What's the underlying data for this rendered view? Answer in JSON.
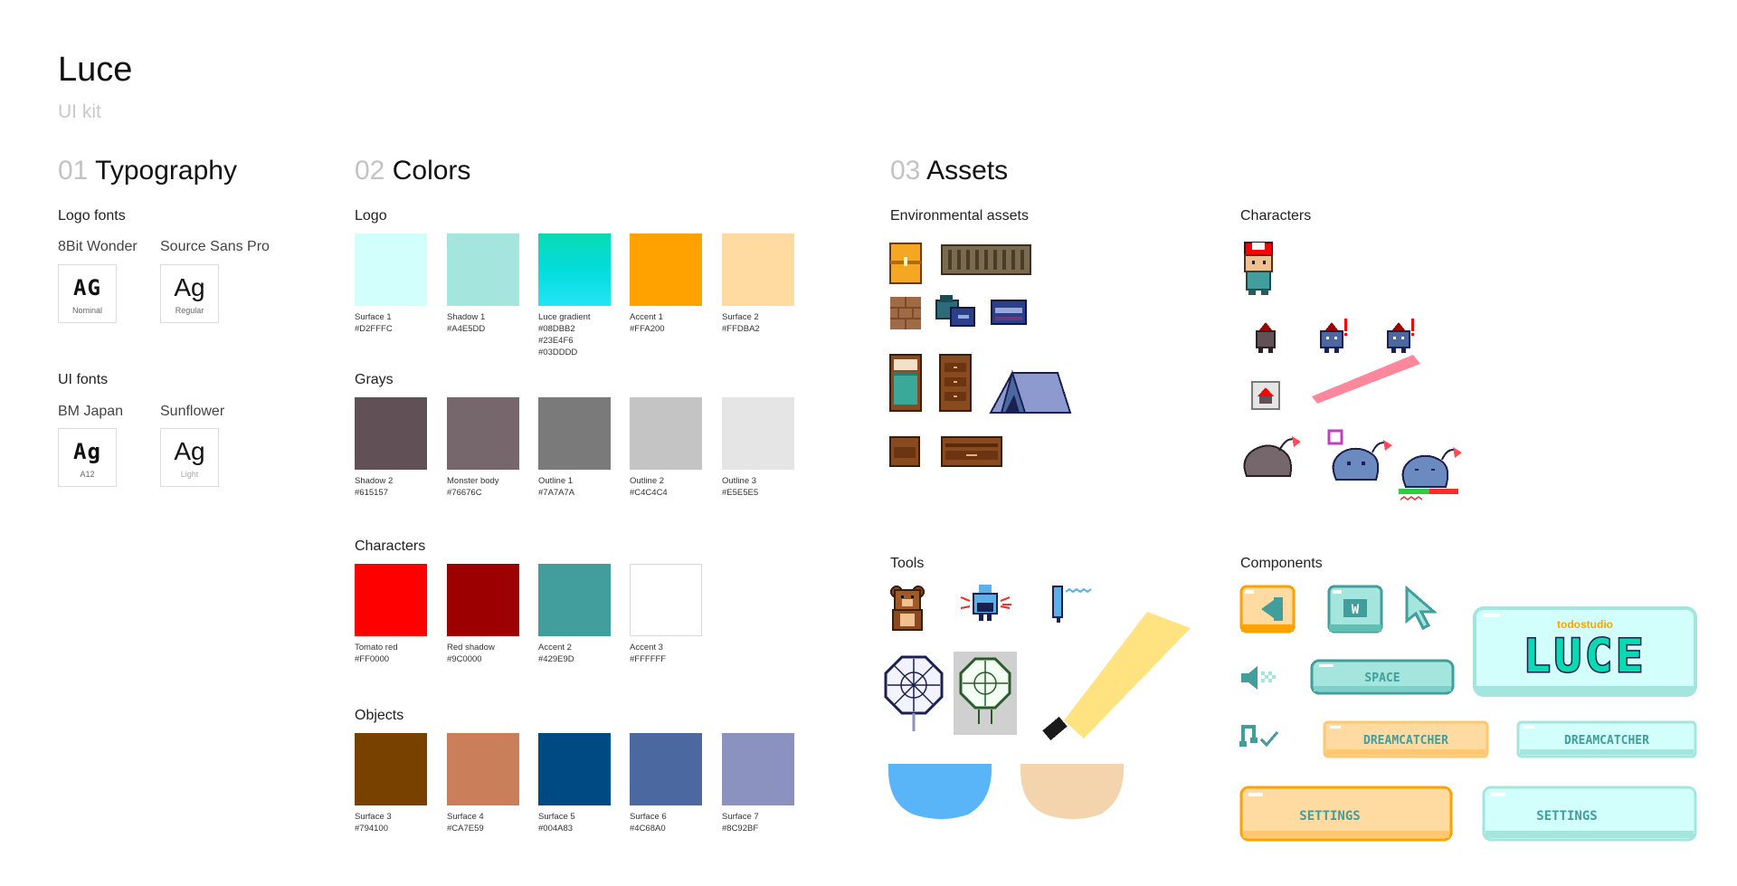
{
  "header": {
    "title": "Luce",
    "subtitle": "UI kit"
  },
  "typography": {
    "num": "01",
    "name": "Typography",
    "logo_fonts": {
      "label": "Logo fonts",
      "fonts": [
        {
          "name": "8Bit Wonder",
          "sample": "AG",
          "style": "Nominal"
        },
        {
          "name": "Source Sans Pro",
          "sample": "Ag",
          "style": "Regular"
        }
      ]
    },
    "ui_fonts": {
      "label": "UI fonts",
      "fonts": [
        {
          "name": "BM Japan",
          "sample": "Ag",
          "style": "A12"
        },
        {
          "name": "Sunflower",
          "sample": "Ag",
          "style": "Light"
        }
      ]
    }
  },
  "colors": {
    "num": "02",
    "name": "Colors",
    "groups": [
      {
        "label": "Logo",
        "swatches": [
          {
            "name": "Surface 1",
            "hex": [
              "#D2FFFC"
            ],
            "fill": "#D2FFFC"
          },
          {
            "name": "Shadow 1",
            "hex": [
              "#A4E5DD"
            ],
            "fill": "#A4E5DD"
          },
          {
            "name": "Luce gradient",
            "hex": [
              "#08DBB2",
              "#23E4F6",
              "#03DDDD"
            ],
            "fill": "#08DBB2",
            "gradient": [
              "#08DBB2",
              "#03DDDD",
              "#23E4F6"
            ]
          },
          {
            "name": "Accent 1",
            "hex": [
              "#FFA200"
            ],
            "fill": "#FFA200"
          },
          {
            "name": "Surface 2",
            "hex": [
              "#FFDBA2"
            ],
            "fill": "#FFDBA2"
          }
        ]
      },
      {
        "label": "Grays",
        "swatches": [
          {
            "name": "Shadow 2",
            "hex": [
              "#615157"
            ],
            "fill": "#615157"
          },
          {
            "name": "Monster body",
            "hex": [
              "#76676C"
            ],
            "fill": "#76676C"
          },
          {
            "name": "Outline 1",
            "hex": [
              "#7A7A7A"
            ],
            "fill": "#7A7A7A"
          },
          {
            "name": "Outline 2",
            "hex": [
              "#C4C4C4"
            ],
            "fill": "#C4C4C4"
          },
          {
            "name": "Outline 3",
            "hex": [
              "#E5E5E5"
            ],
            "fill": "#E5E5E5"
          }
        ]
      },
      {
        "label": "Characters",
        "swatches": [
          {
            "name": "Tomato red",
            "hex": [
              "#FF0000"
            ],
            "fill": "#FF0000"
          },
          {
            "name": "Red shadow",
            "hex": [
              "#9C0000"
            ],
            "fill": "#9C0000"
          },
          {
            "name": "Accent 2",
            "hex": [
              "#429E9D"
            ],
            "fill": "#429E9D"
          },
          {
            "name": "Accent 3",
            "hex": [
              "#FFFFFF"
            ],
            "fill": "#FFFFFF",
            "outlined": true
          }
        ]
      },
      {
        "label": "Objects",
        "swatches": [
          {
            "name": "Surface 3",
            "hex": [
              "#794100"
            ],
            "fill": "#794100"
          },
          {
            "name": "Surface 4",
            "hex": [
              "#CA7E59"
            ],
            "fill": "#CA7E59"
          },
          {
            "name": "Surface 5",
            "hex": [
              "#004A83"
            ],
            "fill": "#004A83"
          },
          {
            "name": "Surface 6",
            "hex": [
              "#4C68A0"
            ],
            "fill": "#4C68A0"
          },
          {
            "name": "Surface 7",
            "hex": [
              "#8C92BF"
            ],
            "fill": "#8C92BF"
          }
        ]
      }
    ]
  },
  "assets": {
    "num": "03",
    "name": "Assets",
    "environmental_label": "Environmental assets",
    "characters_label": "Characters",
    "tools_label": "Tools",
    "components_label": "Components",
    "components": {
      "brand": "todostudio",
      "logo_text": "LUCE",
      "space": "SPACE",
      "dreamcatcher": "DREAMCATCHER",
      "settings": "SETTINGS",
      "w_key": "W"
    }
  }
}
